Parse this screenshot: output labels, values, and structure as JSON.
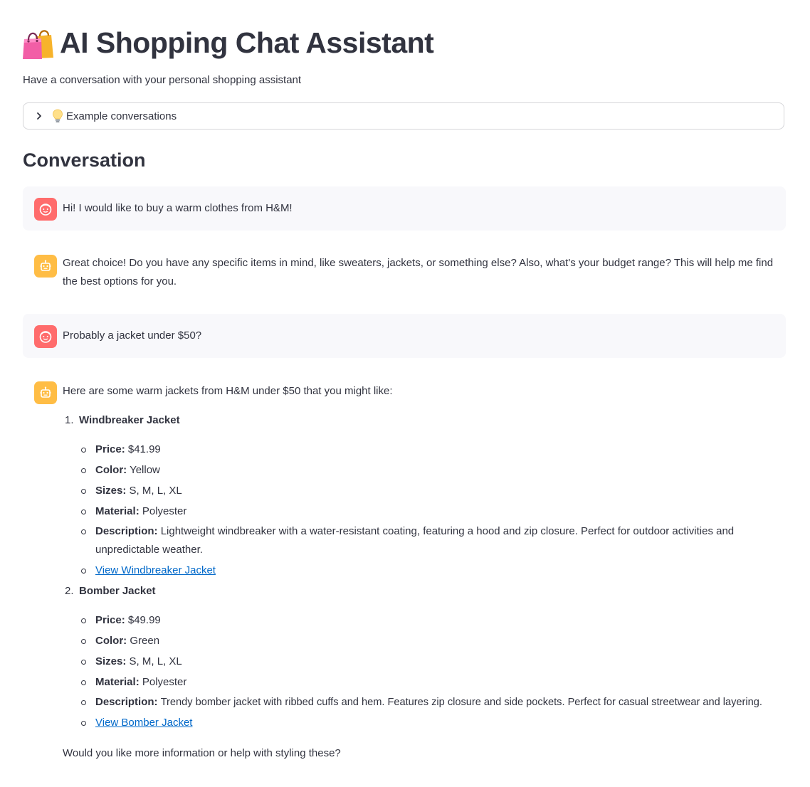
{
  "header": {
    "title": "AI Shopping Chat Assistant",
    "title_icon": "shopping-bags-icon",
    "subtitle": "Have a conversation with your personal shopping assistant"
  },
  "expander": {
    "label": "Example conversations",
    "icon": "light-bulb-icon",
    "expanded": false
  },
  "conversation": {
    "heading": "Conversation",
    "messages": [
      {
        "role": "user",
        "text": "Hi! I would like to buy a warm clothes from H&M!"
      },
      {
        "role": "assistant",
        "text": "Great choice! Do you have any specific items in mind, like sweaters, jackets, or something else? Also, what's your budget range? This will help me find the best options for you."
      },
      {
        "role": "user",
        "text": "Probably a jacket under $50?"
      },
      {
        "role": "assistant",
        "intro": "Here are some warm jackets from H&M under $50 that you might like:",
        "products": [
          {
            "number": "1.",
            "name": "Windbreaker Jacket",
            "price_label": "Price:",
            "price": "$41.99",
            "color_label": "Color:",
            "color": "Yellow",
            "sizes_label": "Sizes:",
            "sizes": "S, M, L, XL",
            "material_label": "Material:",
            "material": "Polyester",
            "description_label": "Description:",
            "description": "Lightweight windbreaker with a water-resistant coating, featuring a hood and zip closure. Perfect for outdoor activities and unpredictable weather.",
            "link_text": "View Windbreaker Jacket"
          },
          {
            "number": "2.",
            "name": "Bomber Jacket",
            "price_label": "Price:",
            "price": "$49.99",
            "color_label": "Color:",
            "color": "Green",
            "sizes_label": "Sizes:",
            "sizes": "S, M, L, XL",
            "material_label": "Material:",
            "material": "Polyester",
            "description_label": "Description:",
            "description": "Trendy bomber jacket with ribbed cuffs and hem. Features zip closure and side pockets. Perfect for casual streetwear and layering.",
            "link_text": "View Bomber Jacket"
          }
        ],
        "outro": "Would you like more information or help with styling these?"
      }
    ]
  },
  "colors": {
    "user_avatar": "#ff6c6c",
    "assistant_avatar": "#ffbd45",
    "link": "#0068c9",
    "text": "#31333f"
  }
}
